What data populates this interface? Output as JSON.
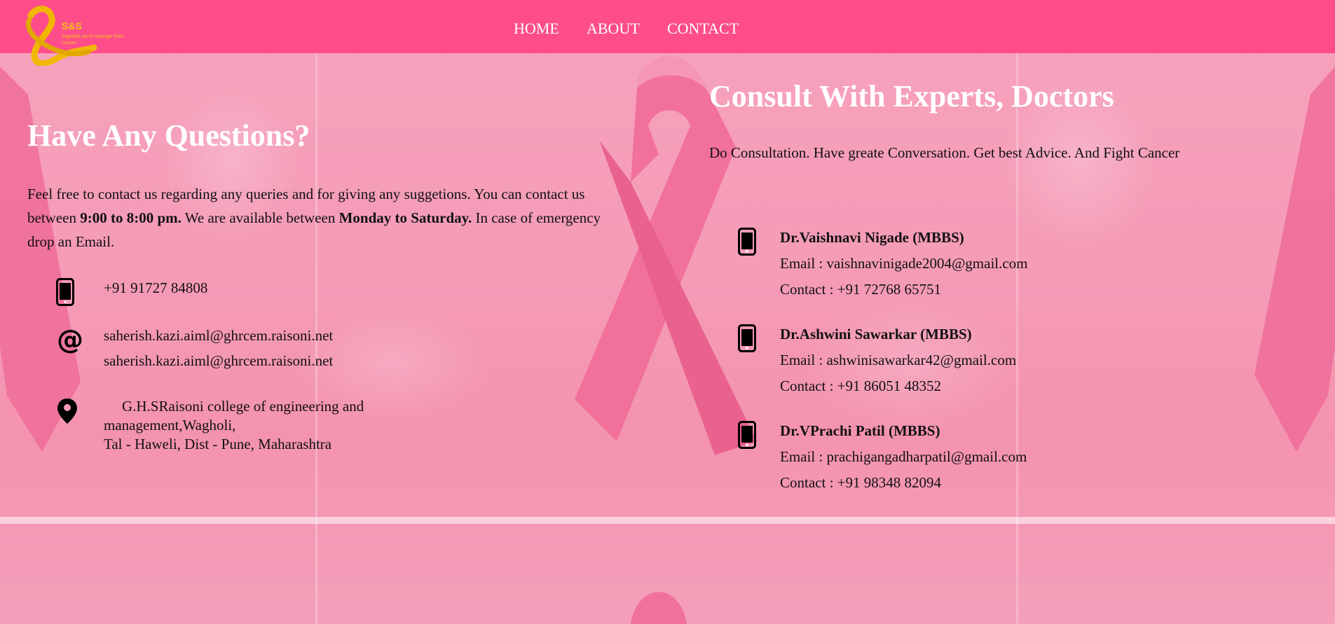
{
  "brand": {
    "name": "S&S",
    "tagline": "Together,we're stronger than cancer."
  },
  "nav": [
    {
      "label": "HOME"
    },
    {
      "label": "ABOUT"
    },
    {
      "label": "CONTACT"
    }
  ],
  "contact": {
    "title": "Have Any Questions?",
    "desc_1": "Feel free to contact us regarding any queries and for giving any suggetions. You can contact us between ",
    "hours": "9:00 to 8:00 pm.",
    "desc_2": " We are available between ",
    "days": "Monday to Saturday.",
    "desc_3": " In case of emergency drop an Email.",
    "phone": "+91 91727 84808",
    "email_1": "saherish.kazi.aiml@ghrcem.raisoni.net",
    "email_2": "saherish.kazi.aiml@ghrcem.raisoni.net",
    "address_1": "G.H.SRaisoni college of engineering and management,Wagholi,",
    "address_2": "Tal - Haweli, Dist - Pune, Maharashtra"
  },
  "experts": {
    "title": "Consult With Experts, Doctors",
    "subtitle": "Do Consultation. Have greate Conversation. Get best Advice. And Fight Cancer",
    "doctors": [
      {
        "name": "Dr.Vaishnavi Nigade (MBBS)",
        "email": "Email : vaishnavinigade2004@gmail.com",
        "contact": "Contact : +91 72768 65751"
      },
      {
        "name": "Dr.Ashwini Sawarkar (MBBS)",
        "email": "Email : ashwinisawarkar42@gmail.com",
        "contact": "Contact : +91 86051 48352"
      },
      {
        "name": "Dr.VPrachi Patil (MBBS)",
        "email": "Email : prachigangadharpatil@gmail.com",
        "contact": "Contact : +91 98348 82094"
      }
    ]
  },
  "colors": {
    "header": "#ff4d8a",
    "logo_gold": "#f2c01a",
    "ribbon": "#f06f9a",
    "background": "#f59bb6"
  },
  "icons": {
    "phone": "phone-icon",
    "email": "at-icon",
    "address": "location-pin-icon"
  }
}
